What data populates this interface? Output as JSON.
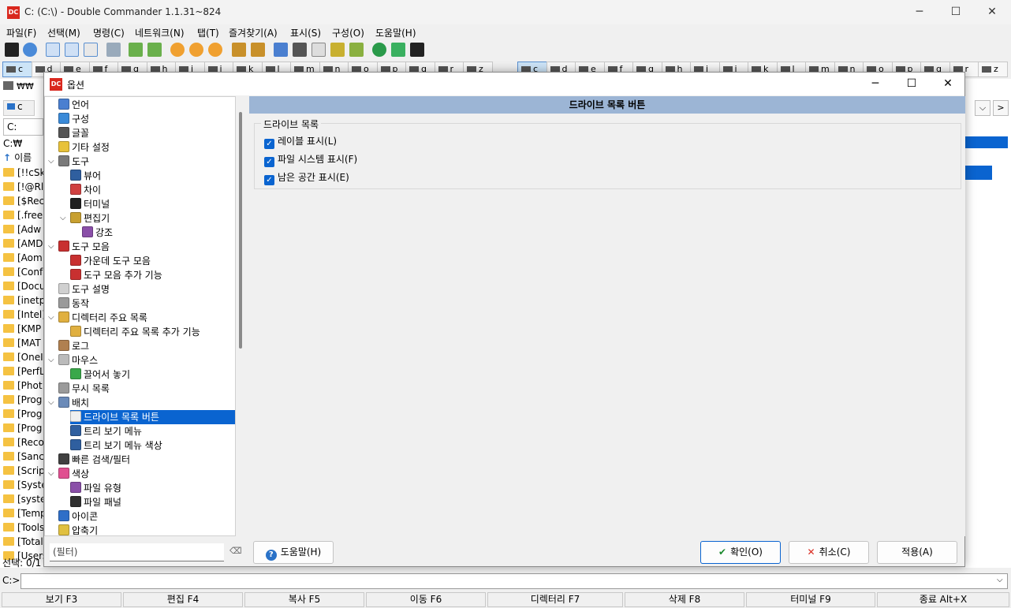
{
  "window": {
    "title": "C: (C:\\) - Double Commander 1.1.31~824",
    "app_icon": "DC",
    "minimize": "─",
    "maximize": "☐",
    "close": "✕"
  },
  "menu": [
    "파일(F)",
    "선택(M)",
    "명령(C)",
    "네트워크(N)",
    "탭(T)",
    "즐겨찾기(A)",
    "표시(S)",
    "구성(O)",
    "도움말(H)"
  ],
  "left_drives": [
    "c",
    "d",
    "e",
    "f",
    "g",
    "h",
    "i",
    "j",
    "k",
    "l",
    "m",
    "n",
    "o",
    "p",
    "q",
    "r",
    "z"
  ],
  "right_drives": [
    "c",
    "d",
    "e",
    "f",
    "g",
    "h",
    "i",
    "j",
    "k",
    "l",
    "m",
    "n",
    "o",
    "p",
    "q",
    "r",
    "z"
  ],
  "left_panel": {
    "net_label": "₩₩",
    "drive_tab": "c",
    "path_combo": "C:",
    "path": "C:₩",
    "col_name": "이름",
    "rows": [
      "[!!cSk",
      "[!@Rl",
      "[$Rec",
      "[.free",
      "[Adw",
      "[AMD",
      "[Aom",
      "[Conf",
      "[Docu",
      "[inetp",
      "[Intel]",
      "[KMP",
      "[MAT",
      "[OneI",
      "[PerfL",
      "[Phot",
      "[Prog",
      "[Prog",
      "[Prog",
      "[Reco",
      "[Sanc",
      "[Scrip",
      "[Syste",
      "[syste",
      "[Temp",
      "[Tools",
      "[Total",
      "[Users"
    ],
    "status": "선택: 0/1"
  },
  "right_panel": {
    "nav_down": "⌵",
    "nav_right": ">"
  },
  "dialog": {
    "title": "옵션",
    "tree": [
      {
        "label": "언어",
        "indent": 0,
        "icon": "language-icon",
        "color": "#4a7fd0"
      },
      {
        "label": "구성",
        "indent": 0,
        "icon": "config-icon",
        "color": "#3a8ad8"
      },
      {
        "label": "글꼴",
        "indent": 0,
        "icon": "font-icon",
        "color": "#555555"
      },
      {
        "label": "기타 설정",
        "indent": 0,
        "icon": "misc-settings-icon",
        "color": "#e8c23a"
      },
      {
        "label": "도구",
        "indent": 0,
        "icon": "tools-icon",
        "color": "#7a7a7a",
        "expanded": true
      },
      {
        "label": "뷰어",
        "indent": 1,
        "icon": "viewer-icon",
        "color": "#2f5f9f"
      },
      {
        "label": "차이",
        "indent": 1,
        "icon": "diff-icon",
        "color": "#d04040"
      },
      {
        "label": "터미널",
        "indent": 1,
        "icon": "terminal-icon",
        "color": "#202020"
      },
      {
        "label": "편집기",
        "indent": 1,
        "icon": "editor-icon",
        "color": "#c8a030",
        "expanded": true
      },
      {
        "label": "강조",
        "indent": 2,
        "icon": "highlight-icon",
        "color": "#8a4fa8"
      },
      {
        "label": "도구 모음",
        "indent": 0,
        "icon": "toolbar-icon",
        "color": "#c83030",
        "expanded": true
      },
      {
        "label": "가운데 도구 모음",
        "indent": 1,
        "icon": "middle-toolbar-icon",
        "color": "#c83030"
      },
      {
        "label": "도구 모음 추가 기능",
        "indent": 1,
        "icon": "toolbar-extra-icon",
        "color": "#c83030"
      },
      {
        "label": "도구 설명",
        "indent": 0,
        "icon": "tooltip-icon",
        "color": "#d0d0d0"
      },
      {
        "label": "동작",
        "indent": 0,
        "icon": "behavior-icon",
        "color": "#9a9a9a"
      },
      {
        "label": "디렉터리 주요 목록",
        "indent": 0,
        "icon": "hotlist-icon",
        "color": "#e0b040",
        "expanded": true
      },
      {
        "label": "디렉터리 주요 목록 추가 기능",
        "indent": 1,
        "icon": "hotlist-extra-icon",
        "color": "#e0b040"
      },
      {
        "label": "로그",
        "indent": 0,
        "icon": "log-icon",
        "color": "#b08050"
      },
      {
        "label": "마우스",
        "indent": 0,
        "icon": "mouse-icon",
        "color": "#bbbbbb",
        "expanded": true
      },
      {
        "label": "끌어서 놓기",
        "indent": 1,
        "icon": "drag-drop-icon",
        "color": "#3aa84a"
      },
      {
        "label": "무시 목록",
        "indent": 0,
        "icon": "ignore-list-icon",
        "color": "#9a9a9a"
      },
      {
        "label": "배치",
        "indent": 0,
        "icon": "layout-icon",
        "color": "#6a8ab8",
        "expanded": true
      },
      {
        "label": "드라이브 목록 버튼",
        "indent": 1,
        "icon": "drive-list-button-icon",
        "color": "#f0f0f0",
        "selected": true
      },
      {
        "label": "트리 보기 메뉴",
        "indent": 1,
        "icon": "tree-view-menu-icon",
        "color": "#2f5f9f"
      },
      {
        "label": "트리 보기 메뉴 색상",
        "indent": 1,
        "icon": "tree-view-color-icon",
        "color": "#2f5f9f"
      },
      {
        "label": "빠른 검색/필터",
        "indent": 0,
        "icon": "quick-search-icon",
        "color": "#404040"
      },
      {
        "label": "색상",
        "indent": 0,
        "icon": "colors-icon",
        "color": "#e05090",
        "expanded": true
      },
      {
        "label": "파일 유형",
        "indent": 1,
        "icon": "file-types-icon",
        "color": "#8a4fa8"
      },
      {
        "label": "파일 패널",
        "indent": 1,
        "icon": "file-panel-icon",
        "color": "#303030"
      },
      {
        "label": "아이콘",
        "indent": 0,
        "icon": "icons-icon",
        "color": "#2f6fc8"
      },
      {
        "label": "압축기",
        "indent": 0,
        "icon": "archiver-icon",
        "color": "#e0c040"
      }
    ],
    "content_title": "드라이브 목록 버튼",
    "group_title": "드라이브 목록",
    "checkboxes": [
      {
        "label": "레이블 표시(L)",
        "checked": true
      },
      {
        "label": "파일 시스템 표시(F)",
        "checked": true
      },
      {
        "label": "남은 공간 표시(E)",
        "checked": true
      }
    ],
    "filter_placeholder": "(필터)",
    "help_button": "도움말(H)",
    "ok_button": "확인(O)",
    "cancel_button": "취소(C)",
    "apply_button": "적용(A)"
  },
  "cmdline": {
    "prompt": "C:>"
  },
  "fkeys": [
    "보기 F3",
    "편집 F4",
    "복사 F5",
    "이동 F6",
    "디렉터리 F7",
    "삭제 F8",
    "터미널 F9",
    "종료 Alt+X"
  ],
  "colors": {
    "accent": "#0a64d0",
    "header_bar": "#9cb5d5",
    "brand": "#d9281e"
  }
}
